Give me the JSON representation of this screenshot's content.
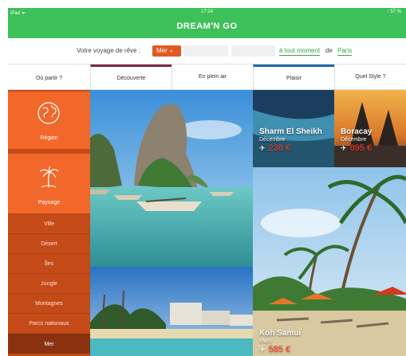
{
  "status_bar": {
    "device": "iPad ᯤ",
    "time": "17:24",
    "battery": "↑ 57 %"
  },
  "app": {
    "brand": "DREAM'N GO"
  },
  "trip_bar": {
    "lead_text": "Votre voyage de rêve :",
    "selected_type": "Mer",
    "when_text": "à tout moment",
    "from_word": "de",
    "city": "Paris"
  },
  "tabs": {
    "where": "Où partir ?",
    "decouverte": "Découverte",
    "plein_air": "En plein air",
    "plaisir": "Plaisir",
    "style": "Quel Style ?"
  },
  "sidebar": {
    "region_label": "Région",
    "paysage_label": "Paysage",
    "items": [
      "Ville",
      "Désert",
      "Îles",
      "Jungle",
      "Montagnes",
      "Parcs nationaux",
      "Mer"
    ],
    "active_item": "Mer"
  },
  "destinations": [
    {
      "name": "Sharm El Sheikh",
      "month": "Décembre",
      "price": "238 €"
    },
    {
      "name": "Boracay",
      "month": "Décembre",
      "price": "895 €"
    },
    {
      "name": "Koh Samui",
      "month": "Mars",
      "price": "585 €"
    }
  ],
  "colors": {
    "header_green": "#3ec05a",
    "accent_orange": "#f2682a",
    "sidebar_dark": "#c44a18",
    "price_red": "#ff3a2a",
    "link_green": "#3a9f4e"
  },
  "icons": {
    "plane": "✈",
    "globe": "globe-icon",
    "palm": "palm-tree-icon"
  }
}
